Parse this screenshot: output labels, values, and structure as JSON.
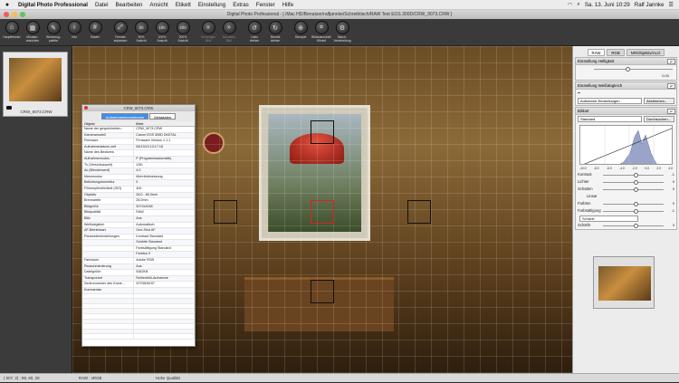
{
  "menubar": {
    "apple": "",
    "app": "Digital Photo Professional",
    "items": [
      "Datei",
      "Bearbeiten",
      "Ansicht",
      "Etikett",
      "Einstellung",
      "Extras",
      "Fenster",
      "Hilfe"
    ],
    "date": "Sa. 13. Juni 10:29",
    "user": "Ralf Jannke"
  },
  "window": {
    "title": "Digital Photo Professional - [ iMac HD/Benutzer/ralfjannke/Schreibtisch/RAW Test EOS 300D/CRW_9073.CRW ]"
  },
  "toolbar": [
    {
      "label": "Hauptfenster",
      "icon": "home-icon",
      "glyph": "⌂",
      "dim": false
    },
    {
      "label": "Miniatur-\nansichten",
      "icon": "thumbnails-icon",
      "glyph": "▦",
      "dim": false
    },
    {
      "label": "Werkzeug-\npalette",
      "icon": "toolpalette-icon",
      "glyph": "✎",
      "dim": false
    },
    {
      "label": "Info",
      "icon": "info-icon",
      "glyph": "i",
      "dim": false
    },
    {
      "label": "Raster",
      "icon": "grid-icon",
      "glyph": "#",
      "dim": false
    },
    {
      "label": "Fenster\nanpassen",
      "icon": "fit-window-icon",
      "glyph": "⤢",
      "dim": false
    },
    {
      "label": "50%\nAnsicht",
      "icon": "zoom-50-icon",
      "glyph": "50",
      "dim": false
    },
    {
      "label": "100%\nAnsicht",
      "icon": "zoom-100-icon",
      "glyph": "100",
      "dim": false
    },
    {
      "label": "200%\nAnsicht",
      "icon": "zoom-200-icon",
      "glyph": "200",
      "dim": false
    },
    {
      "label": "Vorheriges\nBild",
      "icon": "previous-icon",
      "glyph": "«",
      "dim": true
    },
    {
      "label": "Nächstes\nBild",
      "icon": "next-icon",
      "glyph": "»",
      "dim": true
    },
    {
      "label": "Links\ndrehen",
      "icon": "rotate-left-icon",
      "glyph": "↺",
      "dim": false
    },
    {
      "label": "Rechts\ndrehen",
      "icon": "rotate-right-icon",
      "glyph": "↻",
      "dim": false
    },
    {
      "label": "Stempel",
      "icon": "stamp-icon",
      "glyph": "⊕",
      "dim": false
    },
    {
      "label": "Bildausschnitt/\nWinkel",
      "icon": "crop-icon",
      "glyph": "⌗",
      "dim": false
    },
    {
      "label": "Batch-\nVerarbeitung",
      "icon": "batch-icon",
      "glyph": "⚙",
      "dim": false
    }
  ],
  "thumb": {
    "name": "CRW_9073.CRW"
  },
  "info": {
    "title": "CRW_9073.CRW",
    "tabs": [
      "Aufnahmeinformationen",
      "Metadaten"
    ],
    "col1": "Objekt",
    "col2": "Wert",
    "rows": [
      [
        "Name der gespeicherten...",
        "CRW_9073.CRW"
      ],
      [
        "Kameramodell",
        "Canon EOS 300D DIGITAL"
      ],
      [
        "Firmware",
        "Firmware Version 1.1.1"
      ],
      [
        "Aufnahmedatum/-zeit",
        "06/13/15 10:17:18"
      ],
      [
        "Name des Besitzers",
        ""
      ],
      [
        "Aufnahmemodus",
        "P (Programmautomatik)"
      ],
      [
        "Tv (Verschlusszeit)",
        "1/50"
      ],
      [
        "Av (Blendenwert)",
        "4.0"
      ],
      [
        "Messmodus",
        "Mehrfeldmessung"
      ],
      [
        "Belichtungskorrektur",
        "0"
      ],
      [
        "Filmempfindlichkeit (ISO)",
        "400"
      ],
      [
        "Objektiv",
        "28.0 - 80.0mm"
      ],
      [
        "Brennweite",
        "28.0mm"
      ],
      [
        "Bildgröße",
        "3072x2048"
      ],
      [
        "Bildqualität",
        "RAW"
      ],
      [
        "Blitz",
        "Aus"
      ],
      [
        "Weißabgleich",
        "Automatisch"
      ],
      [
        "AF-Betriebsart",
        "One-Shot AF"
      ],
      [
        "Parametereinstellungen",
        "Kontrast  Standard"
      ],
      [
        "",
        "Schärfe  Standard"
      ],
      [
        "",
        "Farbsättigung  Standard"
      ],
      [
        "",
        "Farbton        0"
      ],
      [
        "Farbraum",
        "Adobe RGB"
      ],
      [
        "Rauschminderung",
        "Aus"
      ],
      [
        "Dateigröße",
        "5382KB"
      ],
      [
        "Transportart",
        "Reihenbild-Aufnahme"
      ],
      [
        "Seriennummer des Kame...",
        "2270506157"
      ],
      [
        "Kommentar",
        ""
      ]
    ]
  },
  "right": {
    "tabs": [
      "RAW",
      "RGB",
      "NR/Objektiv/ALO"
    ],
    "brightness": {
      "title": "Einstellung Helligkeit",
      "value": "0,00"
    },
    "wb": {
      "title": "Einstellung Weißabgleich",
      "preset": "Aufnahme-Einstellungen",
      "btn": "Abstimmen..."
    },
    "style": {
      "title": "Bildart",
      "value": "Standard",
      "btn": "Durchsuchen..."
    },
    "histo_ticks": [
      "-10.0",
      "-8.0",
      "-6.0",
      "-4.0",
      "-2.0",
      "0.0",
      "2.0",
      "4.0"
    ],
    "controls": [
      {
        "label": "Kontrast",
        "value": "-1"
      },
      {
        "label": "Lichter",
        "value": "0"
      },
      {
        "label": "Schatten",
        "value": "0"
      },
      {
        "label": "Linear",
        "value": ""
      },
      {
        "label": "Farbton",
        "value": "0"
      },
      {
        "label": "Farbsättigung",
        "value": "-1"
      },
      {
        "label": "Schärfe",
        "value": ""
      },
      {
        "label": "Schärfe",
        "value": "3"
      }
    ]
  },
  "status": {
    "coords": "( 507,  2) : 89, 60, 28",
    "mode": "RAW : sRGB",
    "quality": "Hohe Qualität"
  }
}
